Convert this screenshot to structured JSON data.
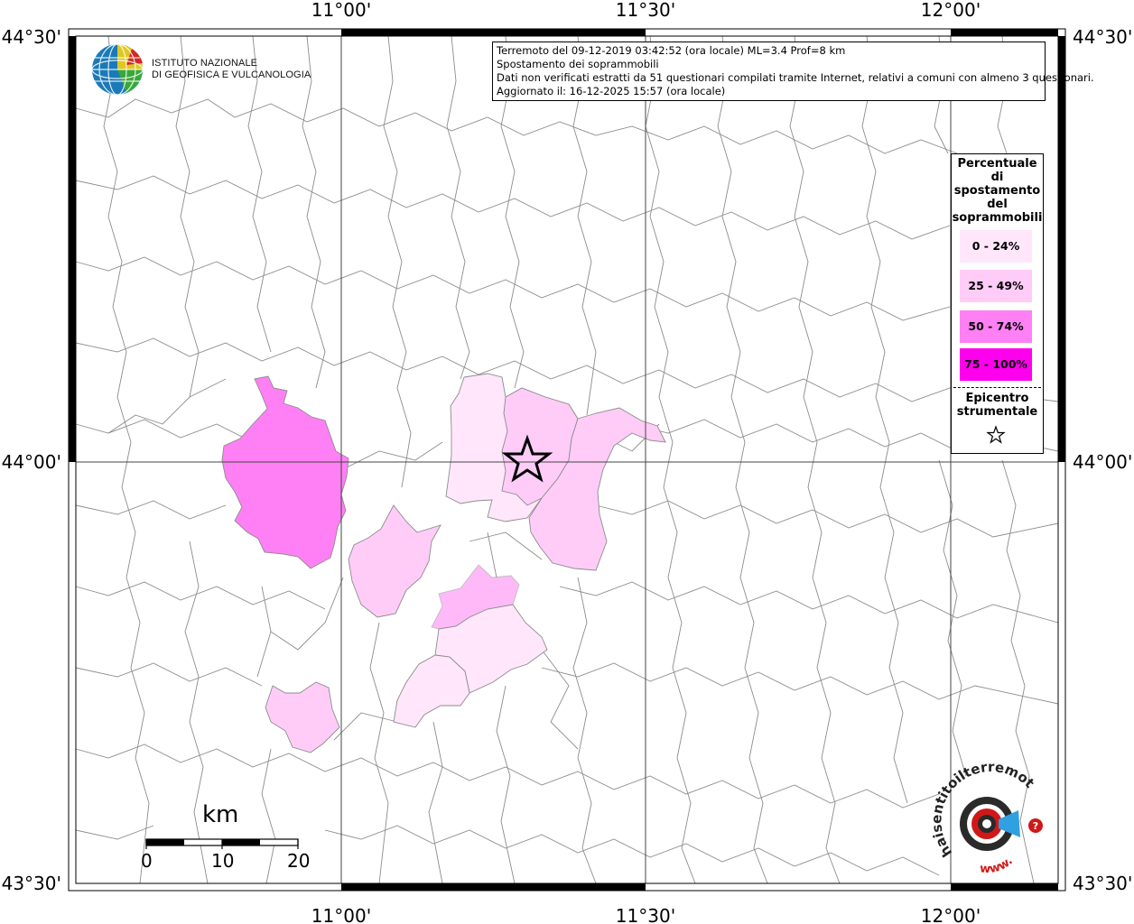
{
  "info_box": {
    "line1": "Terremoto del 09-12-2019 03:42:52 (ora locale) ML=3.4 Prof=8 km",
    "line2": "Spostamento dei soprammobili",
    "line3": "Dati non verificati estratti da 51 questionari compilati tramite Internet, relativi a comuni con almeno 3 questionari.",
    "line4": "Aggiornato il: 16-12-2025 15:57 (ora locale)"
  },
  "logo": {
    "line1": "ISTITUTO NAZIONALE",
    "line2": "DI GEOFISICA E VULCANOLOGIA"
  },
  "axes": {
    "top_ticks": [
      "11°00'",
      "11°30'",
      "12°00'"
    ],
    "bottom_ticks": [
      "11°00'",
      "11°30'",
      "12°00'"
    ],
    "left_ticks": [
      "44°30'",
      "44°00'",
      "43°30'"
    ],
    "right_ticks": [
      "44°30'",
      "44°00'",
      "43°30'"
    ]
  },
  "legend": {
    "title": [
      "Percentuale",
      "di",
      "spostamento",
      "del",
      "soprammobili"
    ],
    "classes": [
      {
        "label": "0 - 24%",
        "color": "#ffe6fb"
      },
      {
        "label": "25 - 49%",
        "color": "#ffccf8"
      },
      {
        "label": "50 - 74%",
        "color": "#ff80f4"
      },
      {
        "label": "75 - 100%",
        "color": "#ff00ee"
      }
    ],
    "epicentre_label": [
      "Epicentro",
      "strumentale"
    ]
  },
  "scale_bar": {
    "unit": "km",
    "labels": [
      "0",
      "10",
      "20"
    ]
  },
  "watermark": {
    "text": "haisentitoilterremoto.it",
    "www": "www."
  },
  "colors": {
    "border_line": "#8c8c8c",
    "grid_line": "#444444",
    "star": "#000000"
  }
}
